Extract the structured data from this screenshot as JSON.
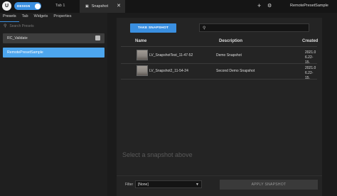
{
  "topbar": {
    "logo_glyph": "U",
    "design_toggle_label": "DESIGN",
    "tab1_label": "Tab 1",
    "snapshot_tab_label": "Snapshot",
    "snapshot_tab_icon": "camera-icon",
    "close_glyph": "✕",
    "add_glyph": "+",
    "settings_glyph": "⚙",
    "preset_name": "RemotePresetSample"
  },
  "left": {
    "tabs": [
      "Presets",
      "Tab",
      "Widgets",
      "Properties"
    ],
    "search_placeholder": "Search Presets",
    "presets": [
      "RC_Validate",
      "RemotePresetSample"
    ]
  },
  "main": {
    "take_snapshot_label": "TAKE SNAPSHOT",
    "search_value": "",
    "search_icon": "search-icon",
    "columns": {
      "name": "Name",
      "description": "Description",
      "created": "Created"
    },
    "rows": [
      {
        "name": "LV_SnapshotTest_11-47-52",
        "description": "Demo Snapshot",
        "created_line1": "2021.0",
        "created_line2": "6.22-15."
      },
      {
        "name": "LV_Snapshot2_11-54-24",
        "description": "Second Demo Snapshot",
        "created_line1": "2021.0",
        "created_line2": "6.22-15."
      }
    ],
    "empty_message": "Select a snapshot above",
    "filter_label": "Filter",
    "filter_value": "[None]",
    "apply_label": "APPLY SNAPSHOT"
  },
  "colors": {
    "accent": "#3a8fe0",
    "selected_preset": "#4da6ee",
    "background": "#1b1b1b",
    "panel": "#242424"
  }
}
